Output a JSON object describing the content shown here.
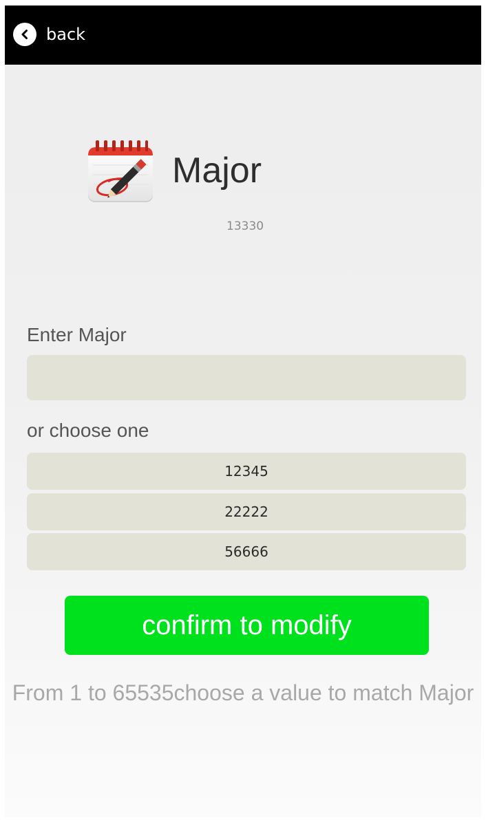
{
  "header": {
    "back_label": "back",
    "back_icon": "chevron-left-icon"
  },
  "page": {
    "icon": "notepad-pencil-icon",
    "title": "Major",
    "current_value": "13330"
  },
  "form": {
    "enter_label": "Enter Major",
    "input_value": "",
    "input_placeholder": "",
    "choose_label": "or choose one",
    "options": [
      {
        "label": "12345"
      },
      {
        "label": "22222"
      },
      {
        "label": "56666"
      }
    ],
    "confirm_label": "confirm to modify"
  },
  "hint": "From 1 to 65535choose a value to match Major",
  "colors": {
    "topbar": "#000000",
    "confirm": "#00e11e",
    "field": "#e3e2d7"
  }
}
